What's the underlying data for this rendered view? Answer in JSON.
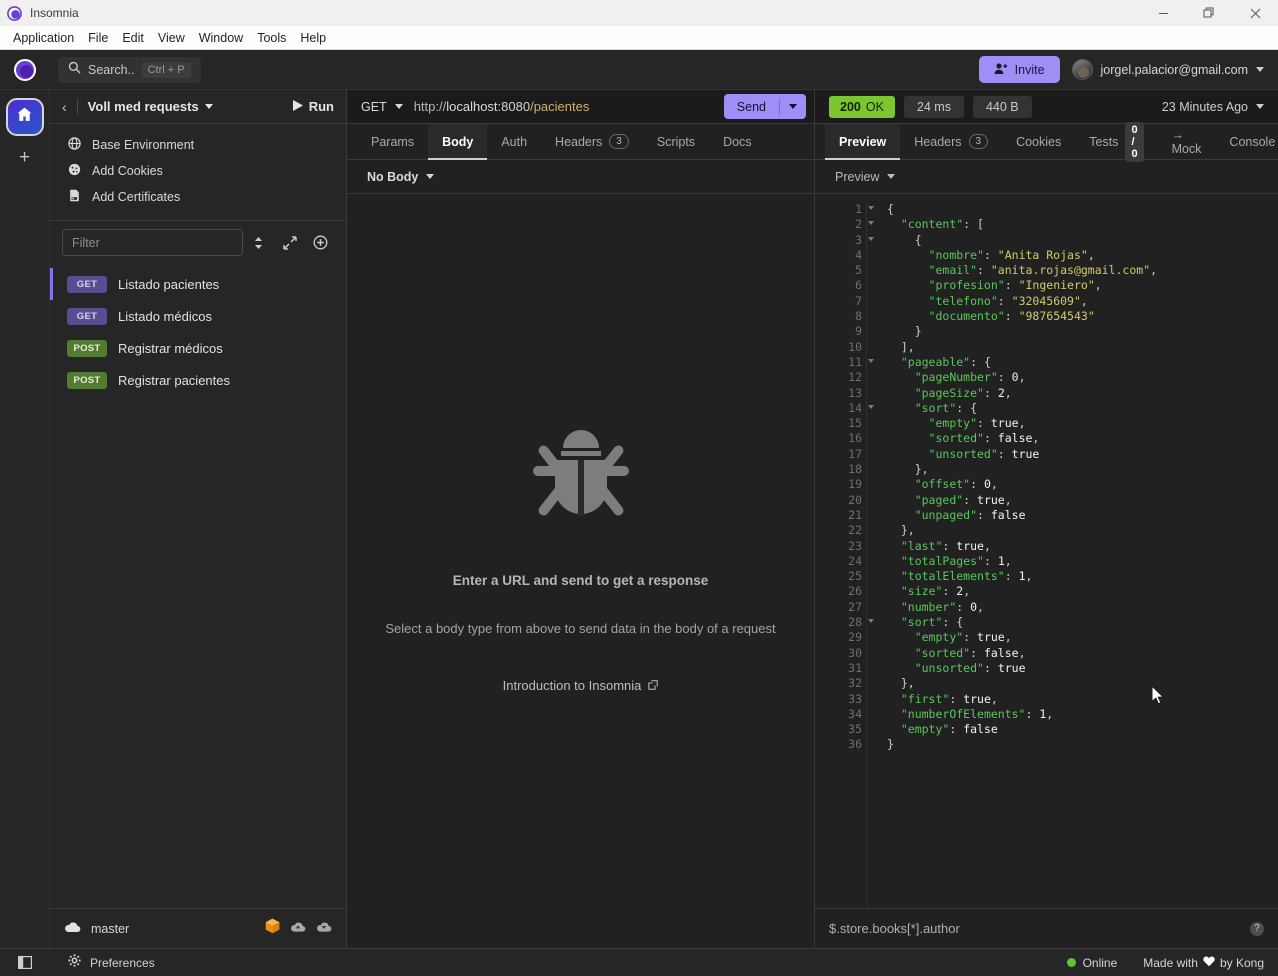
{
  "window": {
    "app_title": "Insomnia",
    "controls": {
      "minimize": "—",
      "maximize": "❐",
      "close": "✕"
    }
  },
  "menubar": {
    "items": [
      "Application",
      "File",
      "Edit",
      "View",
      "Window",
      "Tools",
      "Help"
    ]
  },
  "topbar": {
    "search_label": "Search..",
    "search_shortcut": "Ctrl + P",
    "invite_label": "Invite",
    "account_email": "jorgel.palacior@gmail.com"
  },
  "rail": {
    "home_icon": "home-icon",
    "add_icon": "plus-icon"
  },
  "sidebar": {
    "workspace_name": "Voll med requests",
    "run_label": "Run",
    "environment_items": [
      {
        "label": "Base Environment",
        "icon": "globe-icon"
      },
      {
        "label": "Add Cookies",
        "icon": "cookie-icon"
      },
      {
        "label": "Add Certificates",
        "icon": "certificate-icon"
      }
    ],
    "filter_placeholder": "Filter",
    "filter_value": "",
    "requests": [
      {
        "method": "GET",
        "name": "Listado pacientes",
        "active": true
      },
      {
        "method": "GET",
        "name": "Listado médicos",
        "active": false
      },
      {
        "method": "POST",
        "name": "Registrar médicos",
        "active": false
      },
      {
        "method": "POST",
        "name": "Registrar pacientes",
        "active": false
      }
    ],
    "branch": "master",
    "footer_icons": [
      "cube-icon",
      "cloud-download-icon",
      "cloud-upload-icon"
    ]
  },
  "request": {
    "method": "GET",
    "url_proto": "http://",
    "url_host": "localhost",
    "url_port": ":8080",
    "url_path": "/pacientes",
    "url_full": "http://localhost:8080/pacientes",
    "send_label": "Send",
    "tabs": [
      {
        "label": "Params",
        "active": false,
        "badge": ""
      },
      {
        "label": "Body",
        "active": true,
        "badge": ""
      },
      {
        "label": "Auth",
        "active": false,
        "badge": ""
      },
      {
        "label": "Headers",
        "active": false,
        "badge": "3"
      },
      {
        "label": "Scripts",
        "active": false,
        "badge": ""
      },
      {
        "label": "Docs",
        "active": false,
        "badge": ""
      }
    ],
    "body_type": "No Body",
    "empty_title": "Enter a URL and send to get a response",
    "empty_sub": "Select a body type from above to send data in the body of a request",
    "empty_link": "Introduction to Insomnia"
  },
  "response": {
    "status_code": "200",
    "status_text": "OK",
    "time": "24 ms",
    "size": "440 B",
    "timestamp": "23 Minutes Ago",
    "tabs": [
      {
        "label": "Preview",
        "active": true,
        "badge": "",
        "badge_solid": ""
      },
      {
        "label": "Headers",
        "active": false,
        "badge": "3",
        "badge_solid": ""
      },
      {
        "label": "Cookies",
        "active": false,
        "badge": "",
        "badge_solid": ""
      },
      {
        "label": "Tests",
        "active": false,
        "badge": "",
        "badge_solid": "0 / 0"
      },
      {
        "label": "→ Mock",
        "active": false,
        "badge": "",
        "badge_solid": ""
      },
      {
        "label": "Console",
        "active": false,
        "badge": "",
        "badge_solid": ""
      }
    ],
    "preview_mode": "Preview",
    "jsonpath_placeholder": "$.store.books[*].author",
    "jsonpath_value": "",
    "body_lines": [
      {
        "n": 1,
        "fold": true,
        "indent": 0,
        "tokens": [
          [
            "p",
            "{"
          ]
        ]
      },
      {
        "n": 2,
        "fold": true,
        "indent": 1,
        "tokens": [
          [
            "k",
            "\"content\""
          ],
          [
            "p",
            ": ["
          ]
        ]
      },
      {
        "n": 3,
        "fold": true,
        "indent": 2,
        "tokens": [
          [
            "p",
            "{"
          ]
        ]
      },
      {
        "n": 4,
        "fold": false,
        "indent": 3,
        "tokens": [
          [
            "k",
            "\"nombre\""
          ],
          [
            "p",
            ": "
          ],
          [
            "s",
            "\"Anita Rojas\""
          ],
          [
            "p",
            ","
          ]
        ]
      },
      {
        "n": 5,
        "fold": false,
        "indent": 3,
        "tokens": [
          [
            "k",
            "\"email\""
          ],
          [
            "p",
            ": "
          ],
          [
            "s",
            "\"anita.rojas@gmail.com\""
          ],
          [
            "p",
            ","
          ]
        ]
      },
      {
        "n": 6,
        "fold": false,
        "indent": 3,
        "tokens": [
          [
            "k",
            "\"profesion\""
          ],
          [
            "p",
            ": "
          ],
          [
            "s",
            "\"Ingeniero\""
          ],
          [
            "p",
            ","
          ]
        ]
      },
      {
        "n": 7,
        "fold": false,
        "indent": 3,
        "tokens": [
          [
            "k",
            "\"telefono\""
          ],
          [
            "p",
            ": "
          ],
          [
            "s",
            "\"32045609\""
          ],
          [
            "p",
            ","
          ]
        ]
      },
      {
        "n": 8,
        "fold": false,
        "indent": 3,
        "tokens": [
          [
            "k",
            "\"documento\""
          ],
          [
            "p",
            ": "
          ],
          [
            "s",
            "\"987654543\""
          ]
        ]
      },
      {
        "n": 9,
        "fold": false,
        "indent": 2,
        "tokens": [
          [
            "p",
            "}"
          ]
        ]
      },
      {
        "n": 10,
        "fold": false,
        "indent": 1,
        "tokens": [
          [
            "p",
            "],"
          ]
        ]
      },
      {
        "n": 11,
        "fold": true,
        "indent": 1,
        "tokens": [
          [
            "k",
            "\"pageable\""
          ],
          [
            "p",
            ": {"
          ]
        ]
      },
      {
        "n": 12,
        "fold": false,
        "indent": 2,
        "tokens": [
          [
            "k",
            "\"pageNumber\""
          ],
          [
            "p",
            ": "
          ],
          [
            "n",
            "0"
          ],
          [
            "p",
            ","
          ]
        ]
      },
      {
        "n": 13,
        "fold": false,
        "indent": 2,
        "tokens": [
          [
            "k",
            "\"pageSize\""
          ],
          [
            "p",
            ": "
          ],
          [
            "n",
            "2"
          ],
          [
            "p",
            ","
          ]
        ]
      },
      {
        "n": 14,
        "fold": true,
        "indent": 2,
        "tokens": [
          [
            "k",
            "\"sort\""
          ],
          [
            "p",
            ": {"
          ]
        ]
      },
      {
        "n": 15,
        "fold": false,
        "indent": 3,
        "tokens": [
          [
            "k",
            "\"empty\""
          ],
          [
            "p",
            ": "
          ],
          [
            "b",
            "true"
          ],
          [
            "p",
            ","
          ]
        ]
      },
      {
        "n": 16,
        "fold": false,
        "indent": 3,
        "tokens": [
          [
            "k",
            "\"sorted\""
          ],
          [
            "p",
            ": "
          ],
          [
            "b",
            "false"
          ],
          [
            "p",
            ","
          ]
        ]
      },
      {
        "n": 17,
        "fold": false,
        "indent": 3,
        "tokens": [
          [
            "k",
            "\"unsorted\""
          ],
          [
            "p",
            ": "
          ],
          [
            "b",
            "true"
          ]
        ]
      },
      {
        "n": 18,
        "fold": false,
        "indent": 2,
        "tokens": [
          [
            "p",
            "},"
          ]
        ]
      },
      {
        "n": 19,
        "fold": false,
        "indent": 2,
        "tokens": [
          [
            "k",
            "\"offset\""
          ],
          [
            "p",
            ": "
          ],
          [
            "n",
            "0"
          ],
          [
            "p",
            ","
          ]
        ]
      },
      {
        "n": 20,
        "fold": false,
        "indent": 2,
        "tokens": [
          [
            "k",
            "\"paged\""
          ],
          [
            "p",
            ": "
          ],
          [
            "b",
            "true"
          ],
          [
            "p",
            ","
          ]
        ]
      },
      {
        "n": 21,
        "fold": false,
        "indent": 2,
        "tokens": [
          [
            "k",
            "\"unpaged\""
          ],
          [
            "p",
            ": "
          ],
          [
            "b",
            "false"
          ]
        ]
      },
      {
        "n": 22,
        "fold": false,
        "indent": 1,
        "tokens": [
          [
            "p",
            "},"
          ]
        ]
      },
      {
        "n": 23,
        "fold": false,
        "indent": 1,
        "tokens": [
          [
            "k",
            "\"last\""
          ],
          [
            "p",
            ": "
          ],
          [
            "b",
            "true"
          ],
          [
            "p",
            ","
          ]
        ]
      },
      {
        "n": 24,
        "fold": false,
        "indent": 1,
        "tokens": [
          [
            "k",
            "\"totalPages\""
          ],
          [
            "p",
            ": "
          ],
          [
            "n",
            "1"
          ],
          [
            "p",
            ","
          ]
        ]
      },
      {
        "n": 25,
        "fold": false,
        "indent": 1,
        "tokens": [
          [
            "k",
            "\"totalElements\""
          ],
          [
            "p",
            ": "
          ],
          [
            "n",
            "1"
          ],
          [
            "p",
            ","
          ]
        ]
      },
      {
        "n": 26,
        "fold": false,
        "indent": 1,
        "tokens": [
          [
            "k",
            "\"size\""
          ],
          [
            "p",
            ": "
          ],
          [
            "n",
            "2"
          ],
          [
            "p",
            ","
          ]
        ]
      },
      {
        "n": 27,
        "fold": false,
        "indent": 1,
        "tokens": [
          [
            "k",
            "\"number\""
          ],
          [
            "p",
            ": "
          ],
          [
            "n",
            "0"
          ],
          [
            "p",
            ","
          ]
        ]
      },
      {
        "n": 28,
        "fold": true,
        "indent": 1,
        "tokens": [
          [
            "k",
            "\"sort\""
          ],
          [
            "p",
            ": {"
          ]
        ]
      },
      {
        "n": 29,
        "fold": false,
        "indent": 2,
        "tokens": [
          [
            "k",
            "\"empty\""
          ],
          [
            "p",
            ": "
          ],
          [
            "b",
            "true"
          ],
          [
            "p",
            ","
          ]
        ]
      },
      {
        "n": 30,
        "fold": false,
        "indent": 2,
        "tokens": [
          [
            "k",
            "\"sorted\""
          ],
          [
            "p",
            ": "
          ],
          [
            "b",
            "false"
          ],
          [
            "p",
            ","
          ]
        ]
      },
      {
        "n": 31,
        "fold": false,
        "indent": 2,
        "tokens": [
          [
            "k",
            "\"unsorted\""
          ],
          [
            "p",
            ": "
          ],
          [
            "b",
            "true"
          ]
        ]
      },
      {
        "n": 32,
        "fold": false,
        "indent": 1,
        "tokens": [
          [
            "p",
            "},"
          ]
        ]
      },
      {
        "n": 33,
        "fold": false,
        "indent": 1,
        "tokens": [
          [
            "k",
            "\"first\""
          ],
          [
            "p",
            ": "
          ],
          [
            "b",
            "true"
          ],
          [
            "p",
            ","
          ]
        ]
      },
      {
        "n": 34,
        "fold": false,
        "indent": 1,
        "tokens": [
          [
            "k",
            "\"numberOfElements\""
          ],
          [
            "p",
            ": "
          ],
          [
            "n",
            "1"
          ],
          [
            "p",
            ","
          ]
        ]
      },
      {
        "n": 35,
        "fold": false,
        "indent": 1,
        "tokens": [
          [
            "k",
            "\"empty\""
          ],
          [
            "p",
            ": "
          ],
          [
            "b",
            "false"
          ]
        ]
      },
      {
        "n": 36,
        "fold": false,
        "indent": 0,
        "tokens": [
          [
            "p",
            "}"
          ]
        ]
      }
    ]
  },
  "statusbar": {
    "preferences_label": "Preferences",
    "online_label": "Online",
    "made_with_prefix": "Made with",
    "made_with_suffix": "by Kong"
  },
  "colors": {
    "accent": "#9f8ef5",
    "get_badge": "#5b4b8f",
    "post_badge": "#527a32",
    "status_ok": "#7bc62d",
    "online": "#61c22b",
    "json_key": "#58c75a",
    "json_string": "#d4c96a"
  }
}
